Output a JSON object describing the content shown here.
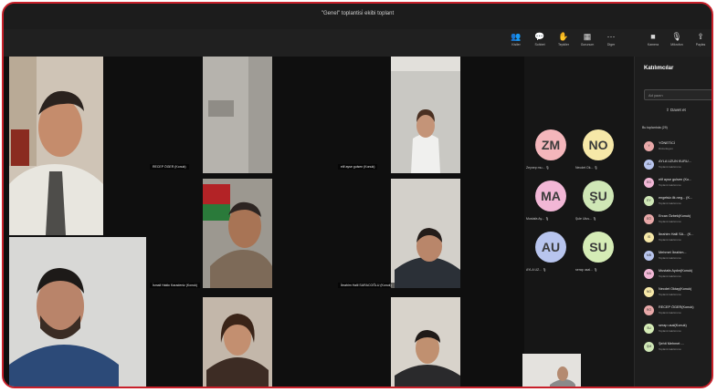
{
  "window": {
    "title": "\"Genel\" toplantisi̇ ekibi toplant"
  },
  "toolbar": [
    {
      "icon": "people-icon",
      "label": "Kisiler"
    },
    {
      "icon": "chat-icon",
      "label": "Sohbet"
    },
    {
      "icon": "hand-icon",
      "label": "Tepkiler"
    },
    {
      "icon": "view-icon",
      "label": "Gorunum"
    },
    {
      "icon": "more-icon",
      "label": "Diger"
    },
    {
      "icon": "camera-icon",
      "label": "Kamera"
    },
    {
      "icon": "mic-icon",
      "label": "Mikrofon"
    },
    {
      "icon": "share-icon",
      "label": "Paylas"
    }
  ],
  "tiles": [
    {
      "name": "RECEP ÖGER (Konuk)"
    },
    {
      "name": "elif ayse gulsen (Konuk)"
    },
    {
      "name": "İsmail Hakkı Karadeniz (Konuk)"
    },
    {
      "name": "İbrahim Halil SARACOĞLU (Konuk)"
    }
  ],
  "avatars": [
    {
      "initials": "ZM",
      "label": "Zeynep mu... 🎙",
      "color": "#f4b6bb"
    },
    {
      "initials": "NO",
      "label": "Necdet Ok... 🎙",
      "color": "#f6e8a8"
    },
    {
      "initials": "MA",
      "label": "Mustafa Ay... 🎙",
      "color": "#f2b7d6"
    },
    {
      "initials": "ŞU",
      "label": "Şule Ulus... 🎙",
      "color": "#cfe7b6"
    },
    {
      "initials": "AU",
      "label": "AYLA UZ... 🎙",
      "color": "#b8c5ee"
    },
    {
      "initials": "SU",
      "label": "serap usal... 🎙",
      "color": "#d5ecb6"
    }
  ],
  "panel": {
    "title": "Katılımcılar",
    "search_placeholder": "Ad yazın",
    "share_label": "Davet et",
    "section_label": "Bu toplantıda (29)",
    "people": [
      {
        "initials": "Y",
        "name": "YÖNETİCİ",
        "sub": "Düzenleyen"
      },
      {
        "initials": "AU",
        "name": "AYLA UZUN KURU...",
        "sub": "Toplantı katılımcısı"
      },
      {
        "initials": "EG",
        "name": "elif ayse gulsen (Ko...",
        "sub": "Toplantı katılımcısı"
      },
      {
        "initials": "EY",
        "name": "engelsiz.ilk.neg... (K...",
        "sub": "Toplantı katılımcısı"
      },
      {
        "initials": "EÖ",
        "name": "Ercan Özbek(Konuk)",
        "sub": "Toplantı katılımcısı"
      },
      {
        "initials": "İS",
        "name": "İbrahim Halil SA... (K...",
        "sub": "Toplantı katılımcısı"
      },
      {
        "initials": "MB",
        "name": "Mehmet İbrahim...",
        "sub": "Toplantı katılımcısı"
      },
      {
        "initials": "MA",
        "name": "Mustafa Aydın(Konuk)",
        "sub": "Toplantı katılımcısı"
      },
      {
        "initials": "NO",
        "name": "Necdet Oktay(Konuk)",
        "sub": "Toplantı katılımcısı"
      },
      {
        "initials": "RÖ",
        "name": "RECEP ÖGER(Konuk)",
        "sub": "Toplantı katılımcısı"
      },
      {
        "initials": "SU",
        "name": "serap usal(Konuk)",
        "sub": "Toplantı katılımcısı"
      },
      {
        "initials": "ŞM",
        "name": "Şehit Mehmet ...",
        "sub": "Toplantı katılımcısı"
      }
    ]
  }
}
